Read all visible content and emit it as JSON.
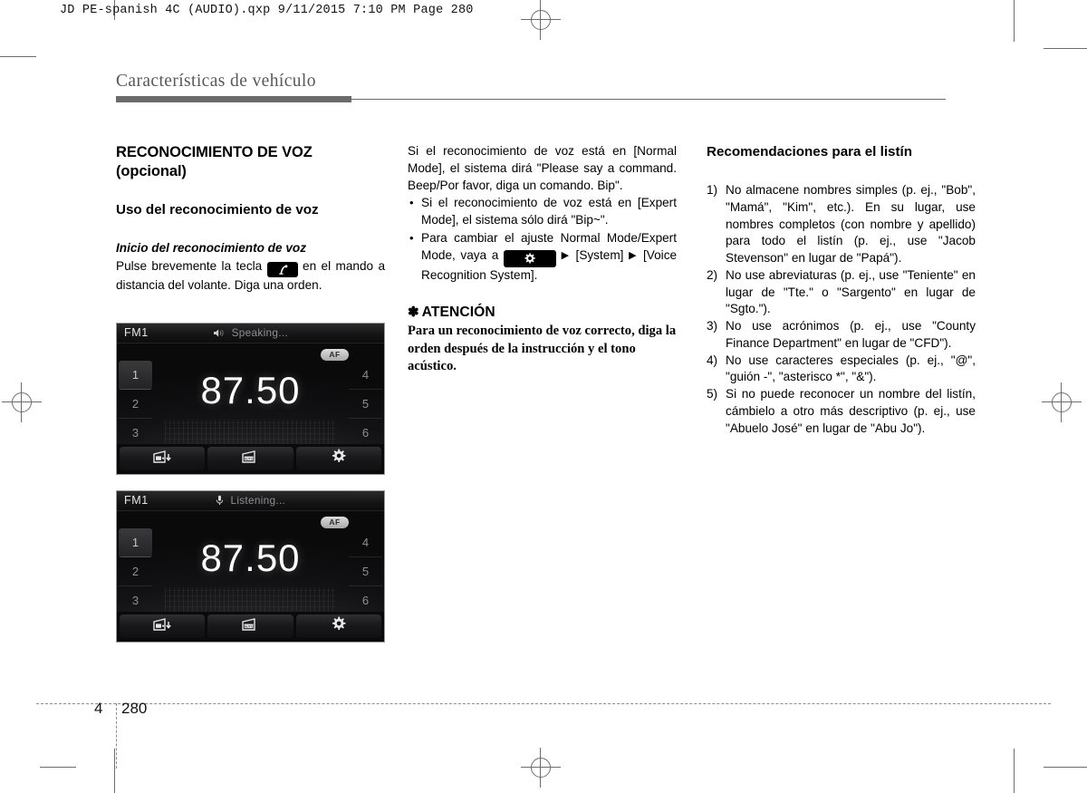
{
  "slug": "JD PE-spanish 4C (AUDIO).qxp   9/11/2015   7:10 PM   Page 280",
  "running_head": "Características de vehículo",
  "column1": {
    "section_title": "RECONOCIMIENTO DE VOZ (opcional)",
    "sub_title": "Uso del reconocimiento de voz",
    "subsub_title": "Inicio del reconocimiento de voz",
    "paragraph_part1": "Pulse brevemente la tecla",
    "paragraph_part2": "en el mando a distancia del volante. Diga una orden.",
    "voice_key_icon": "voice-command-key-icon"
  },
  "column2": {
    "paragraph1": "Si el reconocimiento de voz está en [Normal Mode], el sistema dirá \"Please say a command. Beep/Por favor, diga un comando. Bip\".",
    "bullets": [
      "Si el reconocimiento de voz está en [Expert Mode], el sistema sólo dirá \"Bip~\".",
      "Para cambiar el ajuste Normal Mode/Expert Mode, vaya a"
    ],
    "bullet2_after_icon_1": "[System]",
    "bullet2_after_icon_2": "[Voice Recognition System].",
    "setup_key_icon": "gear-setup-key-icon",
    "arrow_glyph": "▶",
    "attention_star": "✽",
    "attention_title": "ATENCIÓN",
    "attention_body": "Para un reconocimiento de voz correcto, diga la orden después de la instrucción y el tono acústico."
  },
  "column3": {
    "heading": "Recomendaciones para el listín",
    "items": [
      {
        "num": "1)",
        "text": "No almacene nombres simples (p. ej., \"Bob\", \"Mamá\", \"Kim\", etc.). En su lugar, use nombres completos (con nombre y apellido) para todo el listín (p. ej., use \"Jacob Stevenson\" en lugar de \"Papá\")."
      },
      {
        "num": "2)",
        "text": "No use abreviaturas (p. ej., use \"Teniente\" en lugar de \"Tte.\" o \"Sargento\" en lugar de \"Sgto.\")."
      },
      {
        "num": "3)",
        "text": "No use acrónimos (p. ej., use \"County Finance Department\" en lugar de \"CFD\")."
      },
      {
        "num": "4)",
        "text": "No use caracteres especiales (p. ej., \"@\", \"guión -\", \"asterisco *\", \"&\")."
      },
      {
        "num": "5)",
        "text": "Si no puede reconocer un nombre del listín, cámbielo a otro más descriptivo (p. ej., use \"Abuelo José\" en lugar de \"Abu Jo\")."
      }
    ]
  },
  "head_unit_1": {
    "band": "FM1",
    "status": "Speaking...",
    "status_icon": "speaker-sound-icon",
    "af_badge": "AF",
    "frequency": "87.50",
    "presets_left": [
      "1",
      "2",
      "3"
    ],
    "presets_right": [
      "4",
      "5",
      "6"
    ],
    "active_preset": "1",
    "buttons": [
      "radio-save-preset-icon",
      "radio-autostore-icon",
      "settings-gear-icon"
    ]
  },
  "head_unit_2": {
    "band": "FM1",
    "status": "Listening...",
    "status_icon": "microphone-icon",
    "af_badge": "AF",
    "frequency": "87.50",
    "presets_left": [
      "1",
      "2",
      "3"
    ],
    "presets_right": [
      "4",
      "5",
      "6"
    ],
    "active_preset": "1",
    "buttons": [
      "radio-save-preset-icon",
      "radio-autostore-icon",
      "settings-gear-icon"
    ]
  },
  "footer": {
    "chapter": "4",
    "page": "280"
  }
}
